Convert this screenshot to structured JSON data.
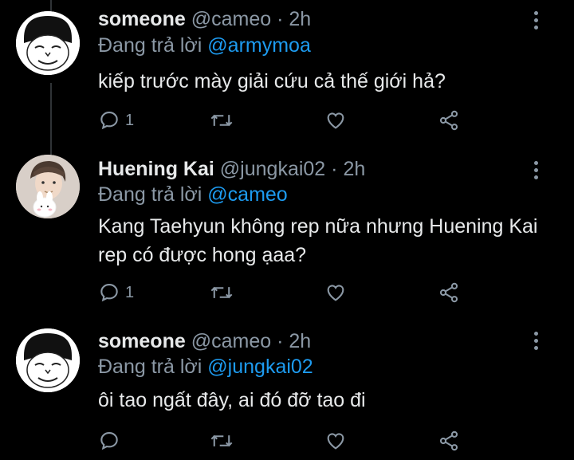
{
  "tweets": [
    {
      "name": "someone",
      "handle": "@cameo",
      "dot": "·",
      "time": "2h",
      "reply_prefix": "Đang trả lời",
      "reply_to": "@armymoa",
      "text": "kiếp trước mày giải cứu cả thế giới hả?",
      "reply_count": "1",
      "avatar_icon": "cartoon-face-icon"
    },
    {
      "name": "Huening Kai",
      "handle": "@jungkai02",
      "dot": "·",
      "time": "2h",
      "reply_prefix": "Đang trả lời",
      "reply_to": "@cameo",
      "text": "Kang Taehyun không rep nữa nhưng Huening Kai rep có được hong ạaa?",
      "reply_count": "1",
      "avatar_icon": "profile-photo-icon"
    },
    {
      "name": "someone",
      "handle": "@cameo",
      "dot": "·",
      "time": "2h",
      "reply_prefix": "Đang trả lời",
      "reply_to": "@jungkai02",
      "text": "ôi tao ngất đây, ai đó đỡ tao đi",
      "reply_count": "",
      "avatar_icon": "cartoon-face-icon"
    }
  ],
  "colors": {
    "background": "#000000",
    "text": "#e7e9ea",
    "muted": "#8b98a5",
    "accent": "#1d9bf0"
  }
}
